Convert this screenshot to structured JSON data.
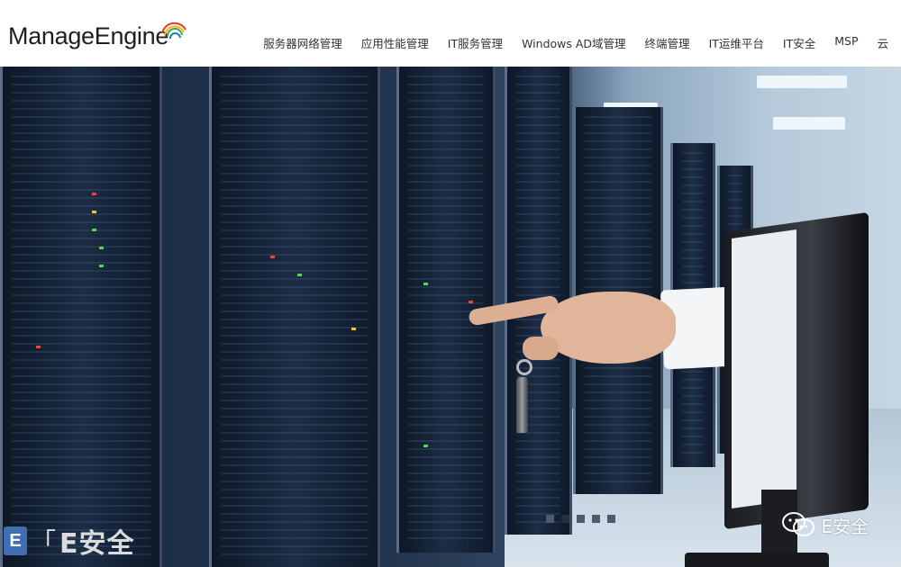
{
  "header": {
    "logo_text": "ManageEngine",
    "logo_arc_colors": [
      "#e53a2f",
      "#f6b318",
      "#3ea84a",
      "#2077c7"
    ],
    "nav": [
      "服务器网络管理",
      "应用性能管理",
      "IT服务管理",
      "Windows AD域管理",
      "终端管理",
      "IT运维平台",
      "IT安全",
      "MSP",
      "云"
    ]
  },
  "hero": {
    "carousel": {
      "slides": 5,
      "active_index": 1
    }
  },
  "watermark": {
    "left_badge": "E",
    "left_bracket": "「",
    "left_text": "E安全",
    "right_text": "E安全"
  },
  "colors": {
    "nav_text": "#333333",
    "hero_dark": "#1b2d47",
    "watermark_blue": "#3f6fb2"
  }
}
